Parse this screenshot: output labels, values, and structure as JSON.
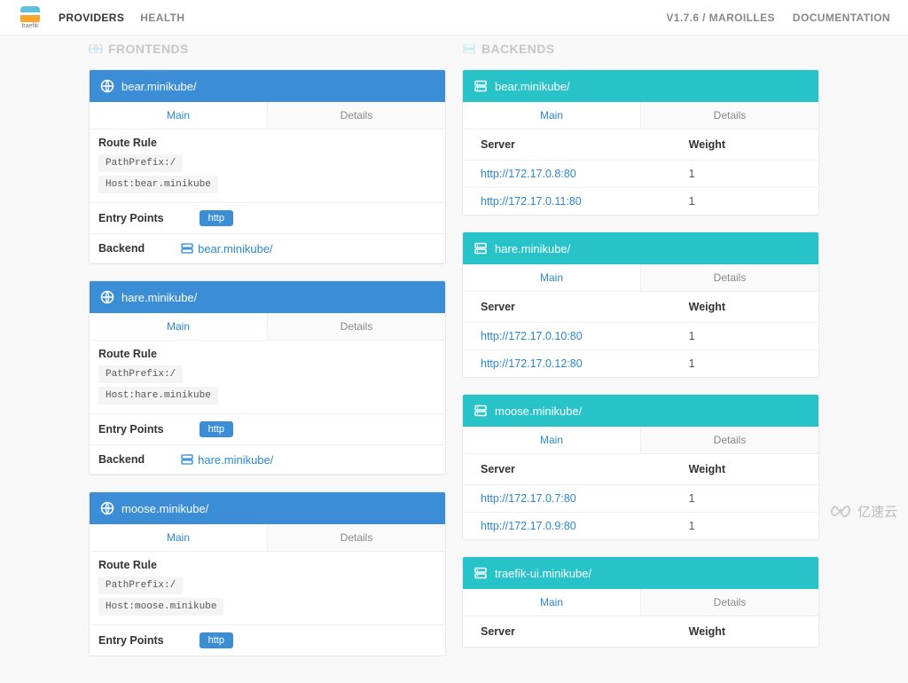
{
  "nav": {
    "logo_text": "traefik",
    "providers": "PROVIDERS",
    "health": "HEALTH",
    "version": "V1.7.6 / MAROILLES",
    "documentation": "DOCUMENTATION"
  },
  "sections": {
    "frontends": "FRONTENDS",
    "backends": "BACKENDS"
  },
  "tabs": {
    "main": "Main",
    "details": "Details"
  },
  "labels": {
    "route_rule": "Route Rule",
    "entry_points": "Entry Points",
    "backend": "Backend",
    "server": "Server",
    "weight": "Weight"
  },
  "proto": {
    "http": "http"
  },
  "frontends": [
    {
      "name": "bear.minikube/",
      "rules": [
        "PathPrefix:/",
        "Host:bear.minikube"
      ],
      "entry_points": [
        "http"
      ],
      "backend": "bear.minikube/"
    },
    {
      "name": "hare.minikube/",
      "rules": [
        "PathPrefix:/",
        "Host:hare.minikube"
      ],
      "entry_points": [
        "http"
      ],
      "backend": "hare.minikube/"
    },
    {
      "name": "moose.minikube/",
      "rules": [
        "PathPrefix:/",
        "Host:moose.minikube"
      ],
      "entry_points": [
        "http"
      ],
      "backend": "moose.minikube/"
    }
  ],
  "backends": [
    {
      "name": "bear.minikube/",
      "servers": [
        {
          "url": "http://172.17.0.8:80",
          "weight": "1"
        },
        {
          "url": "http://172.17.0.11:80",
          "weight": "1"
        }
      ]
    },
    {
      "name": "hare.minikube/",
      "servers": [
        {
          "url": "http://172.17.0.10:80",
          "weight": "1"
        },
        {
          "url": "http://172.17.0.12:80",
          "weight": "1"
        }
      ]
    },
    {
      "name": "moose.minikube/",
      "servers": [
        {
          "url": "http://172.17.0.7:80",
          "weight": "1"
        },
        {
          "url": "http://172.17.0.9:80",
          "weight": "1"
        }
      ]
    },
    {
      "name": "traefik-ui.minikube/",
      "servers": []
    }
  ],
  "watermark": "亿速云"
}
